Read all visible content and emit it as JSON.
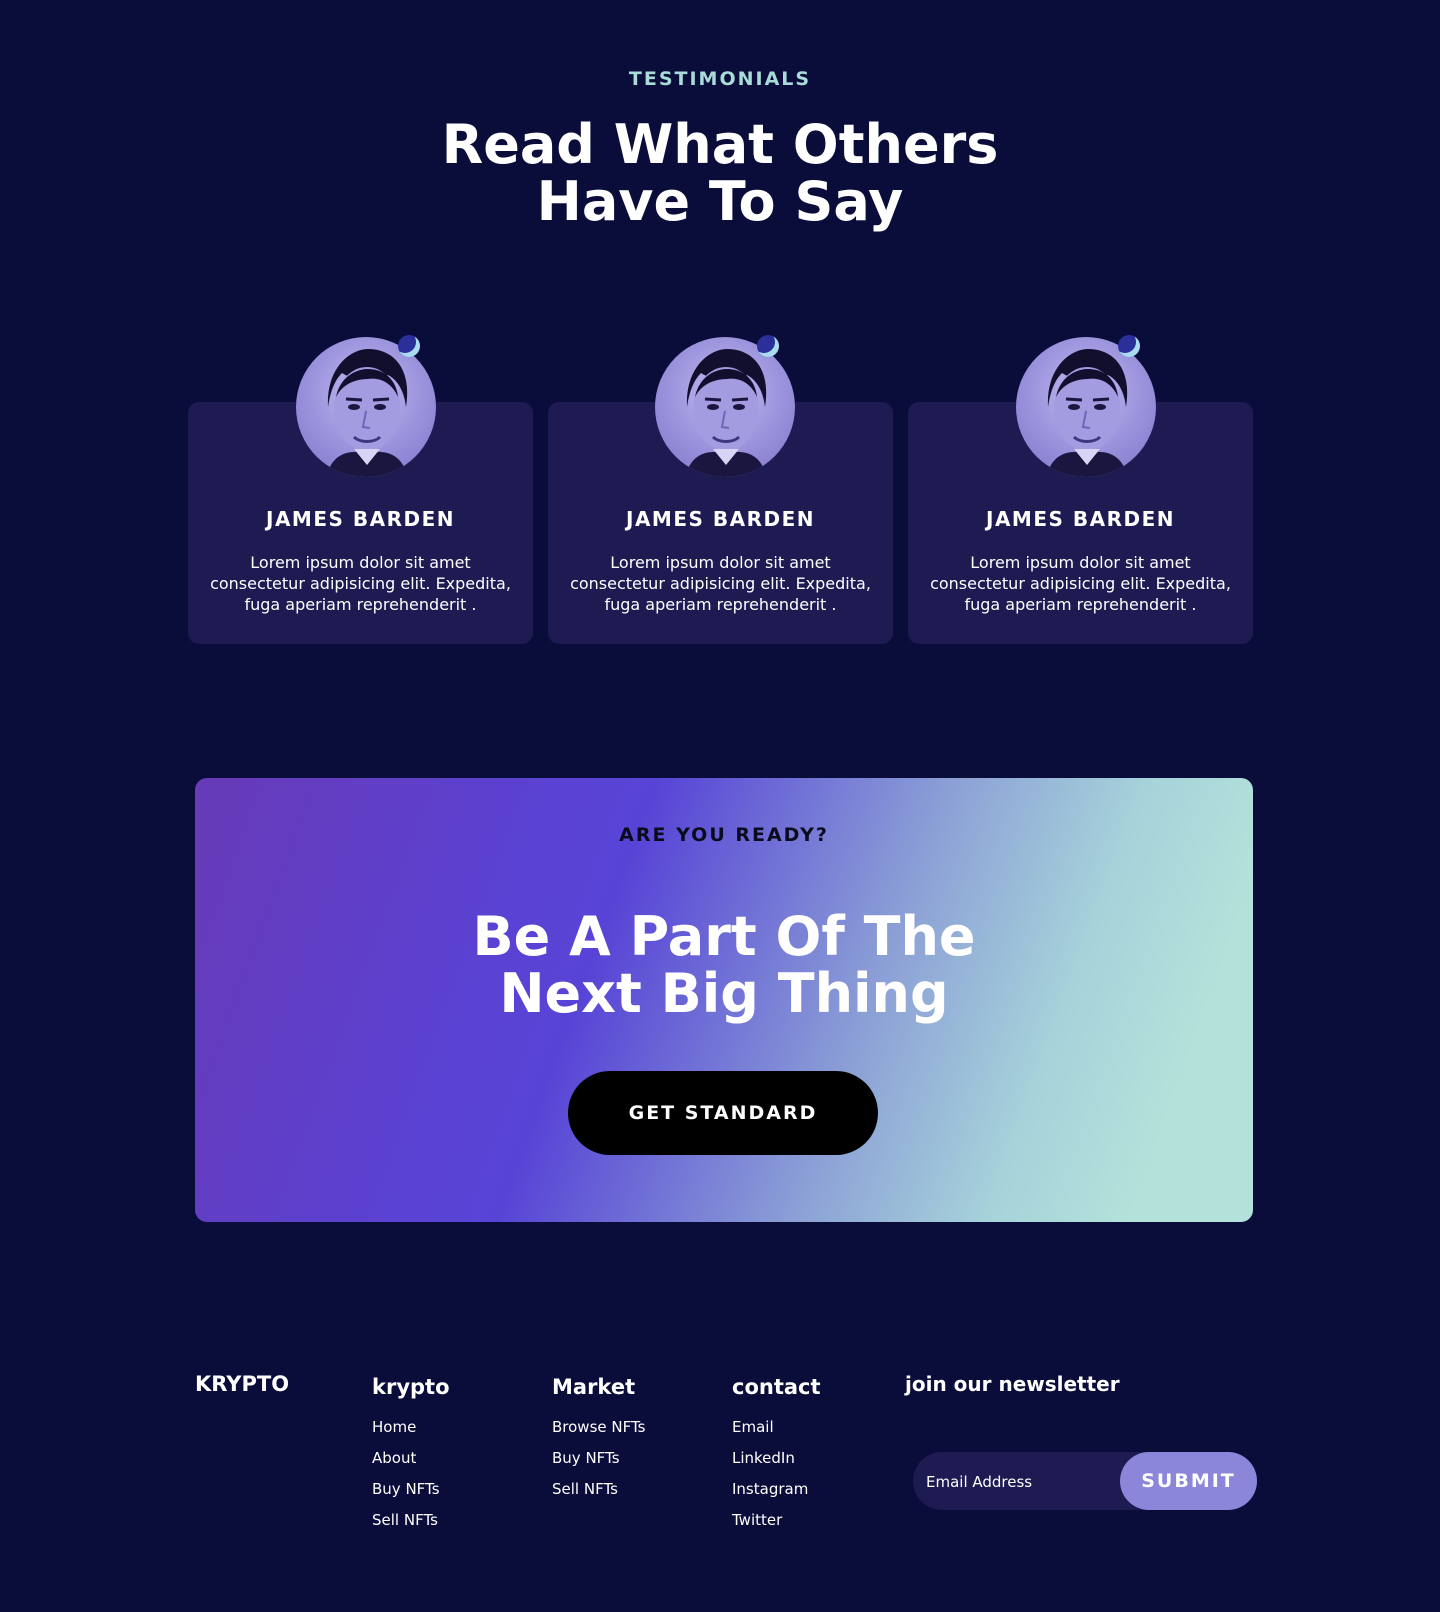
{
  "testimonials": {
    "eyebrow": "TESTIMONIALS",
    "headline_line1": "Read What  Others",
    "headline_line2": "Have To Say",
    "cards": [
      {
        "name": "JAMES BARDEN",
        "text": "Lorem ipsum dolor sit amet consectetur adipisicing elit. Expedita, fuga aperiam reprehenderit ."
      },
      {
        "name": "JAMES BARDEN",
        "text": "Lorem ipsum dolor sit amet consectetur adipisicing elit. Expedita, fuga aperiam reprehenderit ."
      },
      {
        "name": "JAMES BARDEN",
        "text": "Lorem ipsum dolor sit amet consectetur adipisicing elit. Expedita, fuga aperiam reprehenderit ."
      }
    ]
  },
  "cta": {
    "eyebrow": "ARE YOU READY?",
    "title_line1": "Be A Part Of The",
    "title_line2": "Next Big Thing",
    "button_label": "GET STANDARD"
  },
  "footer": {
    "brand": "KRYPTO",
    "columns": [
      {
        "title": "krypto",
        "links": [
          "Home",
          "About",
          "Buy NFTs",
          "Sell NFTs"
        ]
      },
      {
        "title": "Market",
        "links": [
          "Browse NFTs",
          "Buy NFTs",
          "Sell NFTs"
        ]
      },
      {
        "title": "contact",
        "links": [
          "Email",
          "LinkedIn",
          "Instagram",
          "Twitter"
        ]
      }
    ],
    "newsletter": {
      "title": "join our newsletter",
      "placeholder": "Email Address",
      "submit_label": "SUBMIT"
    }
  },
  "colors": {
    "background": "#0a0c3a",
    "card": "#1d1b52",
    "accent_teal": "#a9dcd9",
    "submit": "#8b86da"
  }
}
